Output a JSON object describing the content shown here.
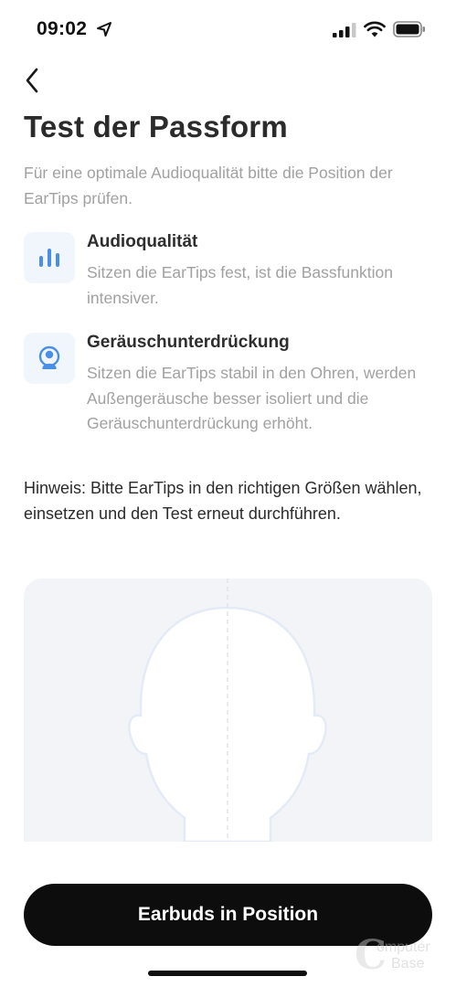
{
  "status_bar": {
    "time": "09:02",
    "icons": [
      "location-arrow-icon",
      "cellular-signal-icon",
      "wifi-icon",
      "battery-icon"
    ]
  },
  "nav": {
    "back_icon": "chevron-left-icon"
  },
  "page": {
    "title": "Test der Passform",
    "intro": "Für eine optimale Audioqualität bitte die Position der EarTips prüfen.",
    "features": [
      {
        "icon": "audio-bars-icon",
        "title": "Audioqualität",
        "description": "Sitzen die EarTips fest, ist die Bassfunktion intensiver."
      },
      {
        "icon": "noise-cancelling-icon",
        "title": "Geräuschunterdrückung",
        "description": "Sitzen die EarTips stabil in den Ohren, werden Außengeräusche besser isoliert und die Geräuschunterdrückung erhöht."
      }
    ],
    "hint": "Hinweis: Bitte EarTips in den richtigen Größen wählen, einsetzen und den Test erneut durchführen."
  },
  "illustration": {
    "icon": "head-outline-illustration"
  },
  "actions": {
    "primary_label": "Earbuds in Position"
  },
  "watermark": {
    "mark": "C",
    "line1": "omputer",
    "line2": "Base"
  },
  "colors": {
    "accent_blue": "#4a8fe6",
    "icon_tile_bg": "#f1f6fd",
    "muted_text": "#a1a1a1",
    "button_bg": "#0d0d0d",
    "panel_bg": "#f2f4f8"
  }
}
